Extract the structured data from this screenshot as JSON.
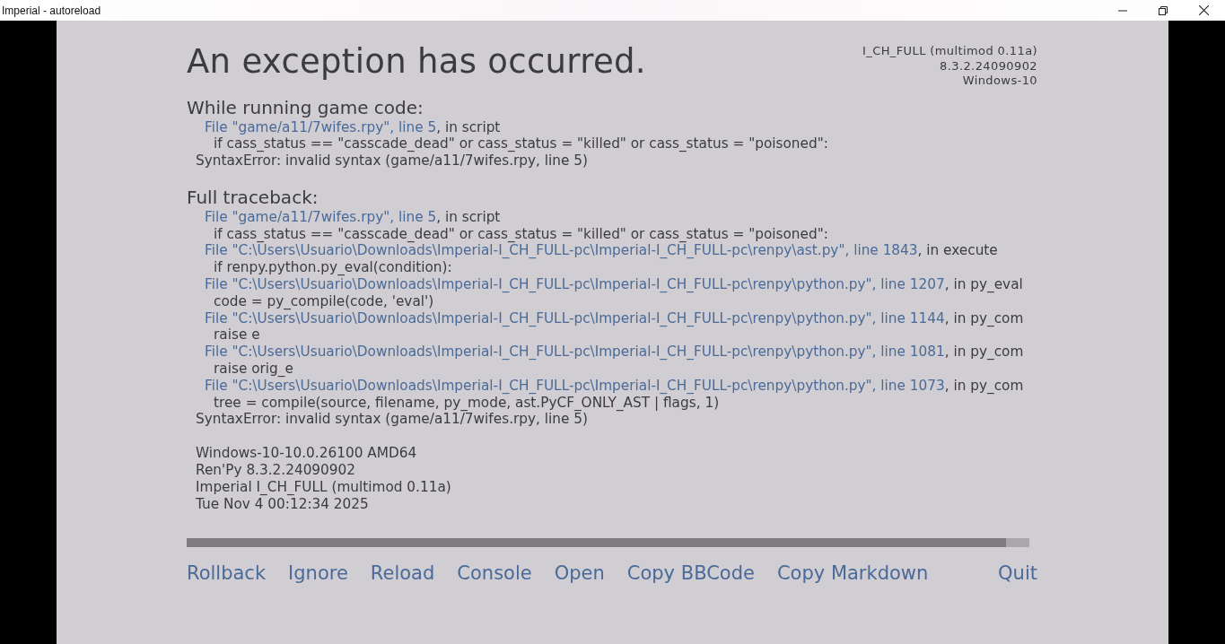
{
  "window": {
    "title": "Imperial - autoreload"
  },
  "header": {
    "title": "An exception has occurred.",
    "version_lines": [
      "I_CH_FULL (multimod 0.11a)",
      "8.3.2.24090902",
      "Windows-10"
    ]
  },
  "sections": [
    {
      "heading": "While running game code:",
      "lines": [
        {
          "kind": "file",
          "link": "File \"game/a11/7wifes.rpy\", line 5",
          "rest": ", in script"
        },
        {
          "kind": "code",
          "text": "if cass_status == \"casscade_dead\" or cass_status = \"killed\" or cass_status = \"poisoned\":"
        },
        {
          "kind": "error",
          "text": "SyntaxError: invalid syntax (game/a11/7wifes.rpy, line 5)"
        }
      ]
    },
    {
      "heading": "Full traceback:",
      "lines": [
        {
          "kind": "file",
          "link": "File \"game/a11/7wifes.rpy\", line 5",
          "rest": ", in script"
        },
        {
          "kind": "code",
          "text": "if cass_status == \"casscade_dead\" or cass_status = \"killed\" or cass_status = \"poisoned\":"
        },
        {
          "kind": "file",
          "link": "File \"C:\\Users\\Usuario\\Downloads\\Imperial-I_CH_FULL-pc\\Imperial-I_CH_FULL-pc\\renpy\\ast.py\", line 1843",
          "rest": ", in execute"
        },
        {
          "kind": "code",
          "text": "if renpy.python.py_eval(condition):"
        },
        {
          "kind": "file",
          "link": "File \"C:\\Users\\Usuario\\Downloads\\Imperial-I_CH_FULL-pc\\Imperial-I_CH_FULL-pc\\renpy\\python.py\", line 1207",
          "rest": ", in py_eval"
        },
        {
          "kind": "code",
          "text": "code = py_compile(code, 'eval')"
        },
        {
          "kind": "file",
          "link": "File \"C:\\Users\\Usuario\\Downloads\\Imperial-I_CH_FULL-pc\\Imperial-I_CH_FULL-pc\\renpy\\python.py\", line 1144",
          "rest": ", in py_com"
        },
        {
          "kind": "code",
          "text": "raise e"
        },
        {
          "kind": "file",
          "link": "File \"C:\\Users\\Usuario\\Downloads\\Imperial-I_CH_FULL-pc\\Imperial-I_CH_FULL-pc\\renpy\\python.py\", line 1081",
          "rest": ", in py_com"
        },
        {
          "kind": "code",
          "text": "raise orig_e"
        },
        {
          "kind": "file",
          "link": "File \"C:\\Users\\Usuario\\Downloads\\Imperial-I_CH_FULL-pc\\Imperial-I_CH_FULL-pc\\renpy\\python.py\", line 1073",
          "rest": ", in py_com"
        },
        {
          "kind": "code",
          "text": "tree = compile(source, filename, py_mode, ast.PyCF_ONLY_AST | flags, 1)"
        },
        {
          "kind": "error",
          "text": "SyntaxError: invalid syntax (game/a11/7wifes.rpy, line 5)"
        }
      ]
    }
  ],
  "system_info": [
    "Windows-10-10.0.26100 AMD64",
    "Ren'Py 8.3.2.24090902",
    "Imperial I_CH_FULL (multimod 0.11a)",
    "Tue Nov  4 00:12:34 2025"
  ],
  "buttons": [
    "Rollback",
    "Ignore",
    "Reload",
    "Console",
    "Open",
    "Copy BBCode",
    "Copy Markdown",
    "Quit"
  ]
}
